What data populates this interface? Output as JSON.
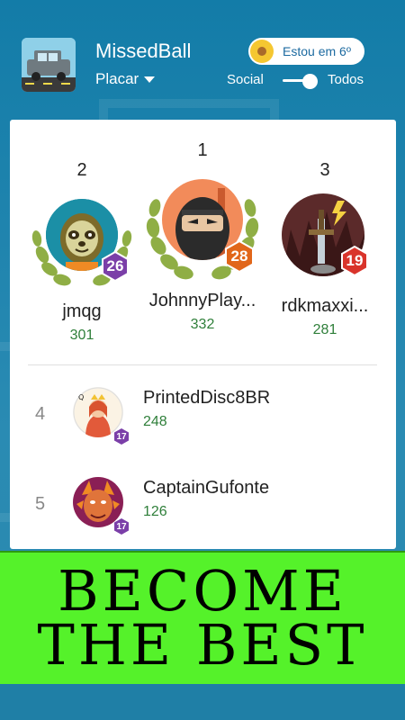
{
  "header": {
    "app_name": "MissedBall",
    "board": "Placar",
    "rank_pill": "Estou em 6º",
    "toggle_left": "Social",
    "toggle_right": "Todos",
    "toggle_on": true
  },
  "podium": [
    {
      "rank": "2",
      "name": "jmqg",
      "score": "301",
      "level": "26",
      "level_color": "#7b3fa8",
      "avatar_icon": "sloth-icon"
    },
    {
      "rank": "1",
      "name": "JohnnyPlay...",
      "score": "332",
      "level": "28",
      "level_color": "#e1661a",
      "avatar_icon": "ninja-icon"
    },
    {
      "rank": "3",
      "name": "rdkmaxxi...",
      "score": "281",
      "level": "19",
      "level_color": "#d9342b",
      "avatar_icon": "sword-icon"
    }
  ],
  "list": [
    {
      "pos": "4",
      "name": "PrintedDisc8BR",
      "score": "248",
      "level": "17",
      "avatar_icon": "queen-card-icon"
    },
    {
      "pos": "5",
      "name": "CaptainGufonte",
      "score": "126",
      "level": "17",
      "avatar_icon": "dragon-icon"
    }
  ],
  "banner": {
    "line1": "BECOME",
    "line2": "THE BEST"
  },
  "colors": {
    "background": "#1f7fa6",
    "banner": "#55f22a",
    "score_green": "#2f7f3a",
    "level_purple": "#7b3fa8"
  }
}
